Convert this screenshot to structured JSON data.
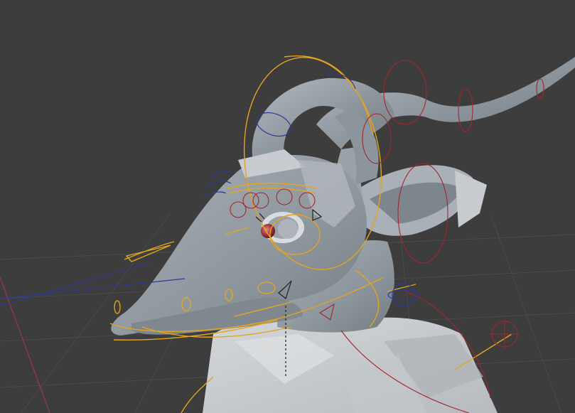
{
  "viewport": {
    "background": "#3d3d3d",
    "grid_color": "#4a4a4a",
    "x_axis_color": "#9a3b43"
  },
  "model": {
    "mesh_color": "#9ba3ab",
    "mesh_shadow_color": "#6c747c",
    "clothing_color": "#c9cdd0",
    "eye_color": "#b5434a"
  },
  "rig": {
    "selected_controls_color": "#e3a520",
    "fk_controls_color": "#2f3a93",
    "ik_controls_color": "#a3262c",
    "bone_line_color": "#202020"
  }
}
